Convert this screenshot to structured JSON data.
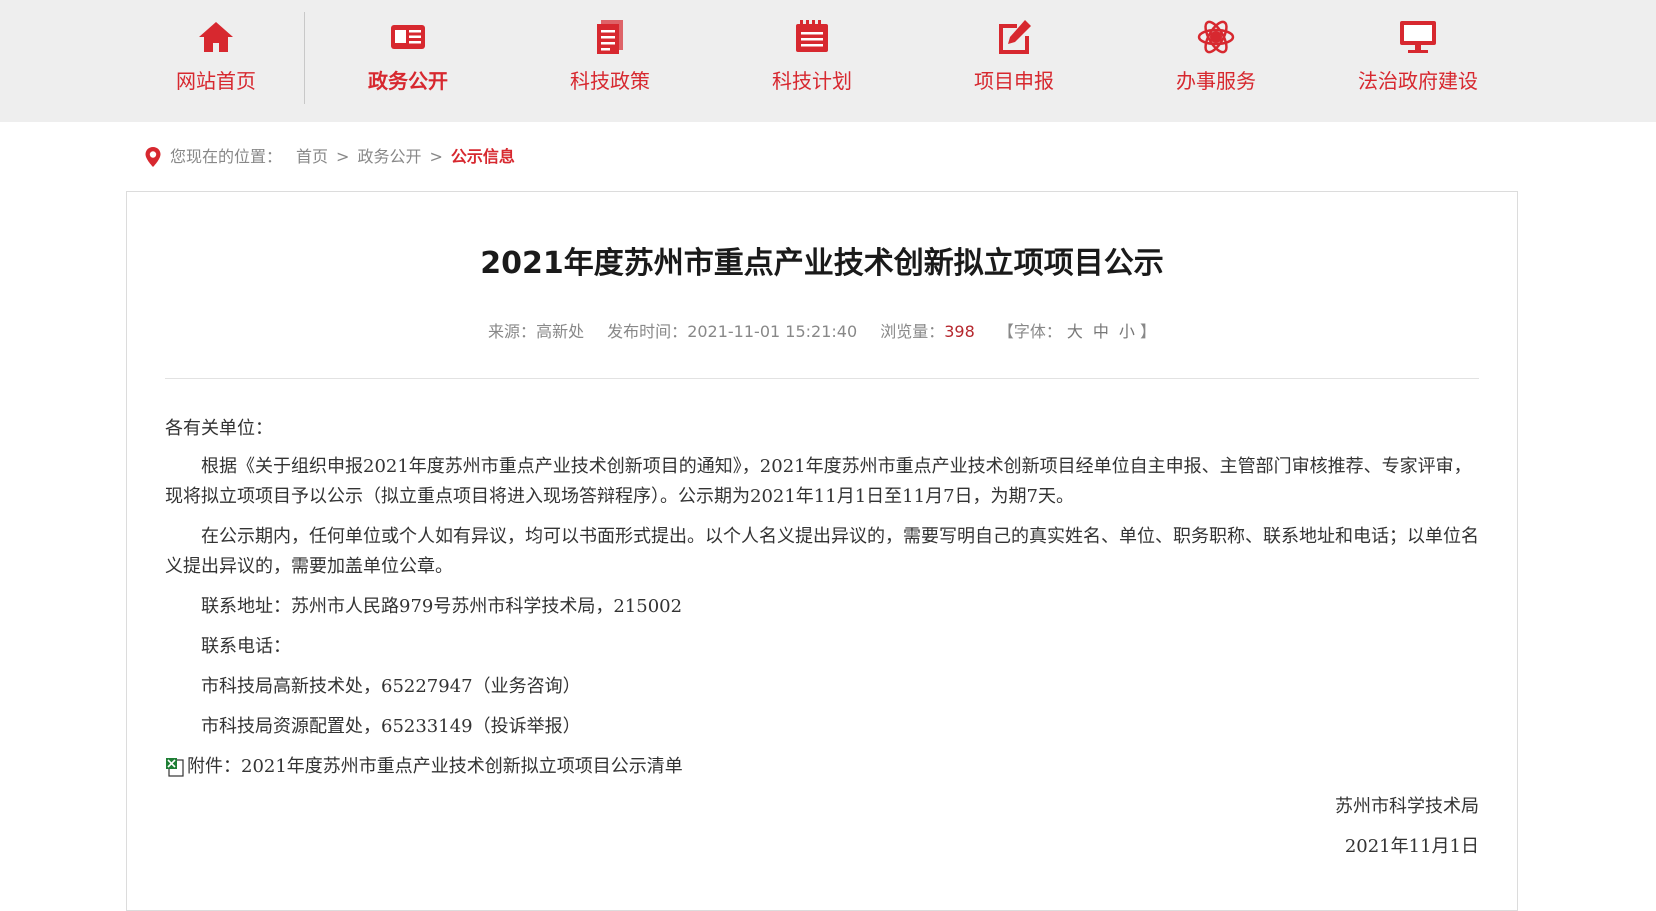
{
  "nav": {
    "items": [
      {
        "label": "网站首页",
        "icon": "home-icon"
      },
      {
        "label": "政务公开",
        "icon": "newspaper-icon"
      },
      {
        "label": "科技政策",
        "icon": "document-icon"
      },
      {
        "label": "科技计划",
        "icon": "calendar-list-icon"
      },
      {
        "label": "项目申报",
        "icon": "edit-icon"
      },
      {
        "label": "办事服务",
        "icon": "atom-icon"
      },
      {
        "label": "法治政府建设",
        "icon": "monitor-icon"
      }
    ],
    "active_index": 1,
    "accent_color": "#d7282f"
  },
  "breadcrumb": {
    "prefix": "您现在的位置：",
    "items": [
      "首页",
      "政务公开"
    ],
    "separator": ">",
    "current": "公示信息"
  },
  "article": {
    "title": "2021年度苏州市重点产业技术创新拟立项项目公示",
    "meta": {
      "source_label": "来源：",
      "source_value": "高新处",
      "published_label": "发布时间：",
      "published_value": "2021-11-01 15:21:40",
      "views_label": "浏览量：",
      "views_value": "398",
      "font_label": "【字体：",
      "font_options": [
        "大",
        "中",
        "小"
      ],
      "font_close": "】"
    },
    "greeting": "各有关单位：",
    "paragraphs": [
      "根据《关于组织申报2021年度苏州市重点产业技术创新项目的通知》，2021年度苏州市重点产业技术创新项目经单位自主申报、主管部门审核推荐、专家评审，现将拟立项项目予以公示（拟立重点项目将进入现场答辩程序）。公示期为2021年11月1日至11月7日，为期7天。",
      "在公示期内，任何单位或个人如有异议，均可以书面形式提出。以个人名义提出异议的，需要写明自己的真实姓名、单位、职务职称、联系地址和电话；以单位名义提出异议的，需要加盖单位公章。",
      "联系地址：苏州市人民路979号苏州市科学技术局，215002",
      "联系电话：",
      "市科技局高新技术处，65227947（业务咨询）",
      "市科技局资源配置处，65233149（投诉举报）"
    ],
    "attachment": {
      "label": "附件：",
      "name": "2021年度苏州市重点产业技术创新拟立项项目公示清单",
      "icon": "excel-file-icon"
    },
    "signoff": {
      "org": "苏州市科学技术局",
      "date": "2021年11月1日"
    }
  }
}
